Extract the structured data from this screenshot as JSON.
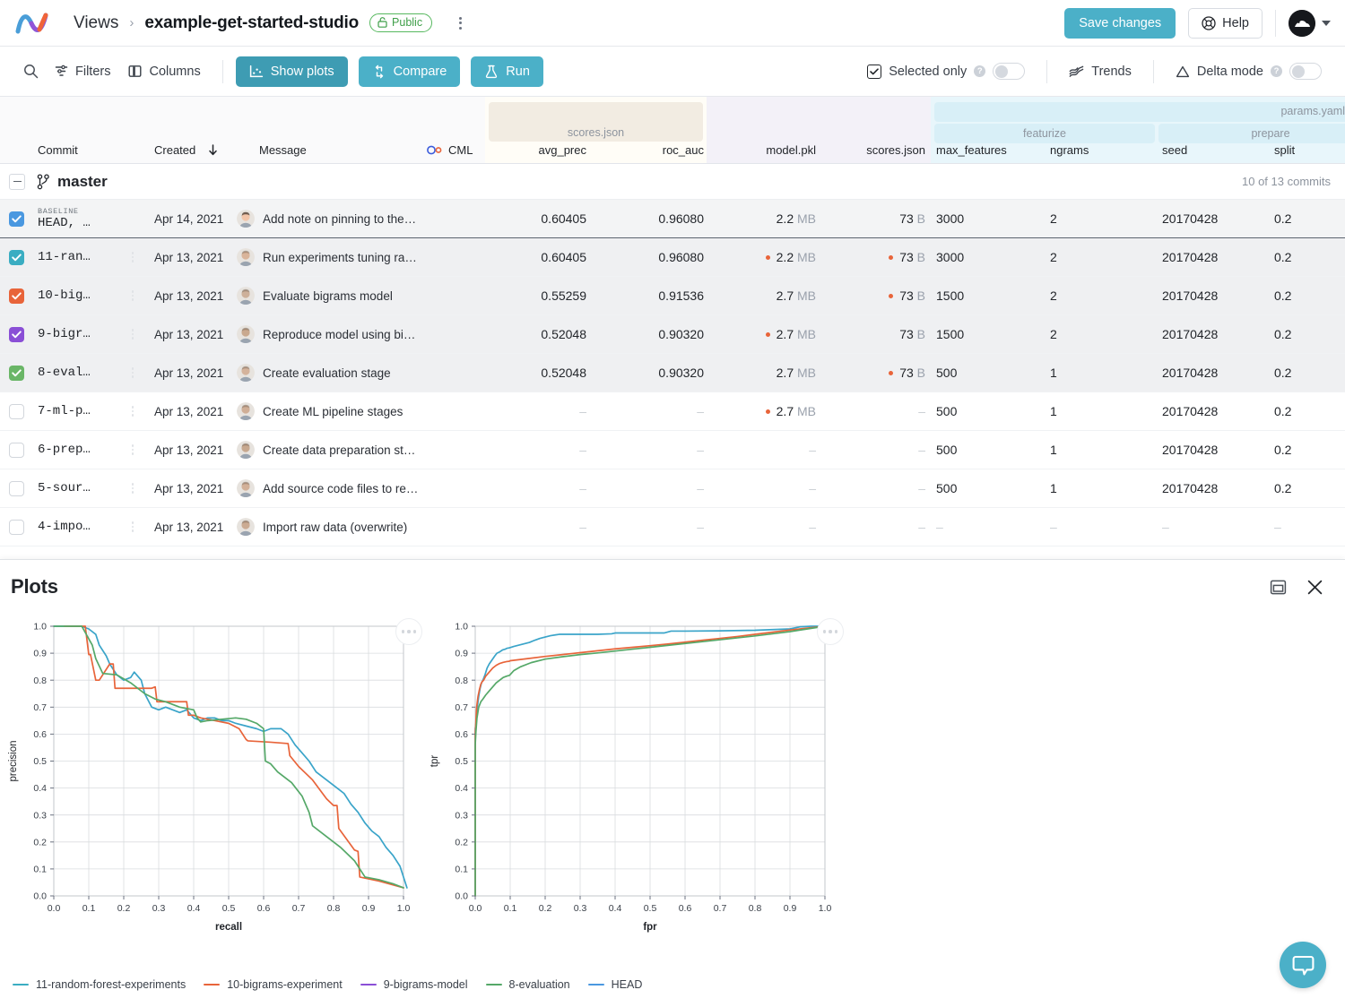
{
  "header": {
    "logo_icon": "iterative-logo-icon",
    "breadcrumb_root": "Views",
    "breadcrumb_sep": "›",
    "title": "example-get-started-studio",
    "visibility_badge": "Public",
    "visibility_icon": "unlock-icon",
    "kebab_icon": "kebab-menu-icon",
    "save_label": "Save changes",
    "help_label": "Help",
    "help_icon": "lifebuoy-icon",
    "avatar_icon": "user-avatar-icon",
    "caret_icon": "chevron-down-icon",
    "accent": "#4bb0c8"
  },
  "toolbar": {
    "search_icon": "search-icon",
    "filters_label": "Filters",
    "filters_icon": "filter-icon",
    "columns_label": "Columns",
    "columns_icon": "columns-icon",
    "show_plots_label": "Show plots",
    "show_plots_icon": "plots-icon",
    "compare_label": "Compare",
    "compare_icon": "compare-icon",
    "run_label": "Run",
    "run_icon": "flask-icon",
    "selected_only_label": "Selected only",
    "selected_only_icon": "checkbox-checked-icon",
    "selected_only_help": "?",
    "trends_label": "Trends",
    "trends_icon": "trends-icon",
    "delta_label": "Delta mode",
    "delta_icon": "delta-triangle-icon",
    "delta_help": "?"
  },
  "table": {
    "columns": [
      {
        "key": "commit",
        "label": "Commit",
        "align": "left"
      },
      {
        "key": "created",
        "label": "Created",
        "align": "left",
        "sort_icon": "sort-desc-arrow-icon"
      },
      {
        "key": "message",
        "label": "Message",
        "align": "left"
      },
      {
        "key": "cml",
        "label": "CML",
        "align": "left",
        "icon": "cml-icon"
      },
      {
        "key": "avg_prec",
        "label": "avg_prec",
        "align": "right"
      },
      {
        "key": "roc_auc",
        "label": "roc_auc",
        "align": "right"
      },
      {
        "key": "model_pkl",
        "label": "model.pkl",
        "align": "right"
      },
      {
        "key": "scores_json",
        "label": "scores.json",
        "align": "right"
      },
      {
        "key": "max_features",
        "label": "max_features",
        "align": "left"
      },
      {
        "key": "ngrams",
        "label": "ngrams",
        "align": "left"
      },
      {
        "key": "seed",
        "label": "seed",
        "align": "left"
      },
      {
        "key": "split",
        "label": "split",
        "align": "left"
      }
    ],
    "groups": [
      {
        "label": "scores.json",
        "level": 1
      },
      {
        "label": "params.yaml",
        "level": 0
      },
      {
        "label": "featurize",
        "level": 1
      },
      {
        "label": "prepare",
        "level": 1
      }
    ],
    "branch": {
      "name": "master",
      "icon": "git-branch-icon",
      "collapse_icon": "collapse-minus-icon",
      "count_label": "10 of 13 commits"
    },
    "rows": [
      {
        "checked": true,
        "color": "#4a98e0",
        "baseline_tag": "BASELINE",
        "commit": "HEAD,  …",
        "created": "Apr 14, 2021",
        "message": "Add note on pinning to the…",
        "avg_prec": "0.60405",
        "roc_auc": "0.96080",
        "model_pkl": "2.2",
        "model_pkl_unit": "MB",
        "model_pkl_mod": false,
        "scores_json": "73",
        "scores_json_unit": "B",
        "scores_json_mod": false,
        "max_features": "3000",
        "ngrams": "2",
        "seed": "20170428",
        "split": "0.2",
        "baseline": true,
        "kebab": false
      },
      {
        "checked": true,
        "color": "#3aadc2",
        "commit": "11-ran…",
        "created": "Apr 13, 2021",
        "message": "Run experiments tuning ra…",
        "avg_prec": "0.60405",
        "roc_auc": "0.96080",
        "model_pkl": "2.2",
        "model_pkl_unit": "MB",
        "model_pkl_mod": true,
        "scores_json": "73",
        "scores_json_unit": "B",
        "scores_json_mod": true,
        "max_features": "3000",
        "ngrams": "2",
        "seed": "20170428",
        "split": "0.2",
        "baseline": false,
        "kebab": true
      },
      {
        "checked": true,
        "color": "#e8643a",
        "commit": "10-big…",
        "created": "Apr 13, 2021",
        "message": "Evaluate bigrams model",
        "avg_prec": "0.55259",
        "roc_auc": "0.91536",
        "model_pkl": "2.7",
        "model_pkl_unit": "MB",
        "model_pkl_mod": false,
        "scores_json": "73",
        "scores_json_unit": "B",
        "scores_json_mod": true,
        "max_features": "1500",
        "ngrams": "2",
        "seed": "20170428",
        "split": "0.2",
        "baseline": false,
        "kebab": true
      },
      {
        "checked": true,
        "color": "#8a4fd6",
        "commit": "9-bigr…",
        "created": "Apr 13, 2021",
        "message": "Reproduce model using bi…",
        "avg_prec": "0.52048",
        "roc_auc": "0.90320",
        "model_pkl": "2.7",
        "model_pkl_unit": "MB",
        "model_pkl_mod": true,
        "scores_json": "73",
        "scores_json_unit": "B",
        "scores_json_mod": false,
        "max_features": "1500",
        "ngrams": "2",
        "seed": "20170428",
        "split": "0.2",
        "baseline": false,
        "kebab": true
      },
      {
        "checked": true,
        "color": "#6ab667",
        "commit": "8-eval…",
        "created": "Apr 13, 2021",
        "message": "Create evaluation stage",
        "avg_prec": "0.52048",
        "roc_auc": "0.90320",
        "model_pkl": "2.7",
        "model_pkl_unit": "MB",
        "model_pkl_mod": false,
        "scores_json": "73",
        "scores_json_unit": "B",
        "scores_json_mod": true,
        "max_features": "500",
        "ngrams": "1",
        "seed": "20170428",
        "split": "0.2",
        "baseline": false,
        "kebab": true
      },
      {
        "checked": false,
        "color": "",
        "commit": "7-ml-p…",
        "created": "Apr 13, 2021",
        "message": "Create ML pipeline stages",
        "avg_prec": "–",
        "roc_auc": "–",
        "model_pkl": "2.7",
        "model_pkl_unit": "MB",
        "model_pkl_mod": true,
        "scores_json": "–",
        "scores_json_unit": "",
        "scores_json_mod": false,
        "max_features": "500",
        "ngrams": "1",
        "seed": "20170428",
        "split": "0.2",
        "baseline": false,
        "kebab": true
      },
      {
        "checked": false,
        "color": "",
        "commit": "6-prep…",
        "created": "Apr 13, 2021",
        "message": "Create data preparation st…",
        "avg_prec": "–",
        "roc_auc": "–",
        "model_pkl": "–",
        "model_pkl_unit": "",
        "model_pkl_mod": false,
        "scores_json": "–",
        "scores_json_unit": "",
        "scores_json_mod": false,
        "max_features": "500",
        "ngrams": "1",
        "seed": "20170428",
        "split": "0.2",
        "baseline": false,
        "kebab": true
      },
      {
        "checked": false,
        "color": "",
        "commit": "5-sour…",
        "created": "Apr 13, 2021",
        "message": "Add source code files to re…",
        "avg_prec": "–",
        "roc_auc": "–",
        "model_pkl": "–",
        "model_pkl_unit": "",
        "model_pkl_mod": false,
        "scores_json": "–",
        "scores_json_unit": "",
        "scores_json_mod": false,
        "max_features": "500",
        "ngrams": "1",
        "seed": "20170428",
        "split": "0.2",
        "baseline": false,
        "kebab": true
      },
      {
        "checked": false,
        "color": "",
        "commit": "4-impo…",
        "created": "Apr 13, 2021",
        "message": "Import raw data (overwrite)",
        "avg_prec": "–",
        "roc_auc": "–",
        "model_pkl": "–",
        "model_pkl_unit": "",
        "model_pkl_mod": false,
        "scores_json": "–",
        "scores_json_unit": "",
        "scores_json_mod": false,
        "max_features": "–",
        "ngrams": "–",
        "seed": "–",
        "split": "–",
        "baseline": false,
        "kebab": true
      }
    ]
  },
  "plots": {
    "title": "Plots",
    "collapse_icon": "panel-collapse-icon",
    "close_icon": "close-icon",
    "menu_icon": "ellipsis-icon",
    "chat_icon": "chat-bubble-icon"
  },
  "legend": {
    "items": [
      {
        "label": "11-random-forest-experiments",
        "color": "#3aadc2"
      },
      {
        "label": "10-bigrams-experiment",
        "color": "#e8643a"
      },
      {
        "label": "9-bigrams-model",
        "color": "#8a4fd6"
      },
      {
        "label": "8-evaluation",
        "color": "#55a868"
      },
      {
        "label": "HEAD",
        "color": "#4a98e0"
      }
    ]
  },
  "chart_data": [
    {
      "type": "line",
      "title": "",
      "xlabel": "recall",
      "ylabel": "precision",
      "xlim": [
        0.0,
        1.0
      ],
      "ylim": [
        0.0,
        1.0
      ],
      "xticks": [
        "0.0",
        "0.1",
        "0.2",
        "0.3",
        "0.4",
        "0.5",
        "0.6",
        "0.7",
        "0.8",
        "0.9",
        "1.0"
      ],
      "yticks": [
        "0.0",
        "0.1",
        "0.2",
        "0.3",
        "0.4",
        "0.5",
        "0.6",
        "0.7",
        "0.8",
        "0.9",
        "1.0"
      ],
      "grid": true,
      "legend_position": "bottom",
      "series": [
        {
          "name": "HEAD",
          "color": "#3aa4c9",
          "x": [
            0.0,
            0.08,
            0.1,
            0.12,
            0.13,
            0.15,
            0.16,
            0.18,
            0.2,
            0.22,
            0.23,
            0.25,
            0.26,
            0.28,
            0.3,
            0.32,
            0.34,
            0.36,
            0.38,
            0.4,
            0.42,
            0.44,
            0.46,
            0.48,
            0.5,
            0.52,
            0.55,
            0.58,
            0.6,
            0.62,
            0.65,
            0.67,
            0.69,
            0.71,
            0.73,
            0.75,
            0.77,
            0.79,
            0.81,
            0.83,
            0.85,
            0.87,
            0.89,
            0.91,
            0.93,
            0.95,
            0.97,
            0.99,
            1.01
          ],
          "y": [
            1.0,
            1.0,
            0.99,
            0.97,
            0.93,
            0.89,
            0.86,
            0.82,
            0.8,
            0.81,
            0.83,
            0.8,
            0.75,
            0.7,
            0.69,
            0.7,
            0.69,
            0.68,
            0.69,
            0.66,
            0.65,
            0.66,
            0.66,
            0.65,
            0.65,
            0.64,
            0.63,
            0.62,
            0.61,
            0.62,
            0.62,
            0.6,
            0.56,
            0.53,
            0.5,
            0.46,
            0.44,
            0.42,
            0.4,
            0.38,
            0.34,
            0.31,
            0.27,
            0.24,
            0.22,
            0.18,
            0.15,
            0.11,
            0.03
          ]
        },
        {
          "name": "10-bigrams-experiment",
          "color": "#e8643a",
          "x": [
            0.03,
            0.05,
            0.09,
            0.1,
            0.105,
            0.12,
            0.13,
            0.16,
            0.17,
            0.175,
            0.19,
            0.23,
            0.28,
            0.29,
            0.295,
            0.32,
            0.36,
            0.38,
            0.385,
            0.4,
            0.42,
            0.46,
            0.5,
            0.53,
            0.55,
            0.555,
            0.62,
            0.67,
            0.675,
            0.7,
            0.74,
            0.78,
            0.8,
            0.81,
            0.815,
            0.86,
            0.87,
            0.875,
            0.93,
            1.0
          ],
          "y": [
            1.0,
            1.0,
            1.0,
            0.895,
            0.895,
            0.8,
            0.8,
            0.86,
            0.86,
            0.77,
            0.77,
            0.77,
            0.77,
            0.775,
            0.72,
            0.72,
            0.72,
            0.72,
            0.67,
            0.67,
            0.66,
            0.65,
            0.64,
            0.62,
            0.58,
            0.575,
            0.57,
            0.565,
            0.52,
            0.48,
            0.43,
            0.36,
            0.335,
            0.335,
            0.25,
            0.17,
            0.165,
            0.07,
            0.055,
            0.03
          ]
        },
        {
          "name": "8-evaluation",
          "color": "#55a868",
          "x": [
            0.0,
            0.08,
            0.11,
            0.12,
            0.14,
            0.18,
            0.22,
            0.26,
            0.29,
            0.32,
            0.36,
            0.4,
            0.41,
            0.42,
            0.44,
            0.48,
            0.52,
            0.55,
            0.58,
            0.6,
            0.605,
            0.62,
            0.64,
            0.68,
            0.71,
            0.73,
            0.74,
            0.78,
            0.82,
            0.86,
            0.88,
            0.89,
            0.93,
            0.97,
            1.0
          ],
          "y": [
            1.0,
            1.0,
            0.93,
            0.88,
            0.825,
            0.82,
            0.79,
            0.75,
            0.73,
            0.72,
            0.7,
            0.69,
            0.66,
            0.645,
            0.65,
            0.655,
            0.66,
            0.655,
            0.64,
            0.62,
            0.5,
            0.49,
            0.46,
            0.42,
            0.37,
            0.31,
            0.26,
            0.22,
            0.18,
            0.13,
            0.09,
            0.07,
            0.06,
            0.045,
            0.03
          ]
        }
      ]
    },
    {
      "type": "line",
      "title": "",
      "xlabel": "fpr",
      "ylabel": "tpr",
      "xlim": [
        0.0,
        1.0
      ],
      "ylim": [
        0.0,
        1.0
      ],
      "xticks": [
        "0.0",
        "0.1",
        "0.2",
        "0.3",
        "0.4",
        "0.5",
        "0.6",
        "0.7",
        "0.8",
        "0.9",
        "1.0"
      ],
      "yticks": [
        "0.0",
        "0.1",
        "0.2",
        "0.3",
        "0.4",
        "0.5",
        "0.6",
        "0.7",
        "0.8",
        "0.9",
        "1.0"
      ],
      "grid": true,
      "legend_position": "bottom",
      "series": [
        {
          "name": "HEAD",
          "color": "#3aa4c9",
          "x": [
            0.0,
            0.0,
            0.004,
            0.006,
            0.01,
            0.014,
            0.018,
            0.022,
            0.028,
            0.034,
            0.04,
            0.048,
            0.056,
            0.062,
            0.07,
            0.078,
            0.086,
            0.09,
            0.098,
            0.11,
            0.125,
            0.14,
            0.155,
            0.17,
            0.185,
            0.2,
            0.215,
            0.23,
            0.24,
            0.25,
            0.3,
            0.35,
            0.39,
            0.4,
            0.45,
            0.5,
            0.54,
            0.56,
            0.6,
            0.7,
            0.8,
            0.9,
            0.93,
            0.96,
            1.0
          ],
          "y": [
            0.0,
            0.62,
            0.66,
            0.7,
            0.74,
            0.77,
            0.79,
            0.8,
            0.82,
            0.845,
            0.86,
            0.875,
            0.89,
            0.9,
            0.905,
            0.912,
            0.915,
            0.918,
            0.92,
            0.925,
            0.93,
            0.935,
            0.94,
            0.948,
            0.955,
            0.96,
            0.965,
            0.968,
            0.97,
            0.97,
            0.97,
            0.97,
            0.972,
            0.975,
            0.975,
            0.975,
            0.975,
            0.982,
            0.982,
            0.983,
            0.985,
            0.99,
            0.998,
            1.0,
            1.0
          ]
        },
        {
          "name": "10-bigrams-experiment",
          "color": "#e8643a",
          "x": [
            0.0,
            0.0,
            0.002,
            0.004,
            0.008,
            0.012,
            0.016,
            0.02,
            0.024,
            0.03,
            0.04,
            0.05,
            0.06,
            0.07,
            0.08,
            0.09,
            0.097,
            0.1,
            0.15,
            0.2,
            0.25,
            0.3,
            0.35,
            0.4,
            0.45,
            0.5,
            0.55,
            0.6,
            0.65,
            0.7,
            0.75,
            0.8,
            0.85,
            0.9,
            0.95,
            1.0
          ],
          "y": [
            0.0,
            0.6,
            0.65,
            0.7,
            0.74,
            0.765,
            0.785,
            0.795,
            0.8,
            0.815,
            0.83,
            0.845,
            0.855,
            0.862,
            0.866,
            0.869,
            0.87,
            0.872,
            0.88,
            0.888,
            0.895,
            0.902,
            0.909,
            0.916,
            0.922,
            0.928,
            0.934,
            0.941,
            0.948,
            0.955,
            0.962,
            0.97,
            0.978,
            0.986,
            0.993,
            1.0
          ]
        },
        {
          "name": "8-evaluation",
          "color": "#55a868",
          "x": [
            0.0,
            0.0,
            0.002,
            0.005,
            0.01,
            0.016,
            0.022,
            0.03,
            0.04,
            0.05,
            0.06,
            0.07,
            0.08,
            0.09,
            0.098,
            0.11,
            0.13,
            0.16,
            0.2,
            0.25,
            0.3,
            0.35,
            0.4,
            0.45,
            0.5,
            0.55,
            0.6,
            0.65,
            0.7,
            0.75,
            0.8,
            0.85,
            0.9,
            0.95,
            1.0
          ],
          "y": [
            0.0,
            0.56,
            0.61,
            0.66,
            0.7,
            0.72,
            0.73,
            0.745,
            0.76,
            0.775,
            0.79,
            0.8,
            0.81,
            0.815,
            0.818,
            0.835,
            0.85,
            0.865,
            0.878,
            0.887,
            0.895,
            0.901,
            0.908,
            0.915,
            0.922,
            0.929,
            0.936,
            0.943,
            0.95,
            0.957,
            0.964,
            0.972,
            0.98,
            0.99,
            1.0
          ]
        }
      ]
    }
  ]
}
